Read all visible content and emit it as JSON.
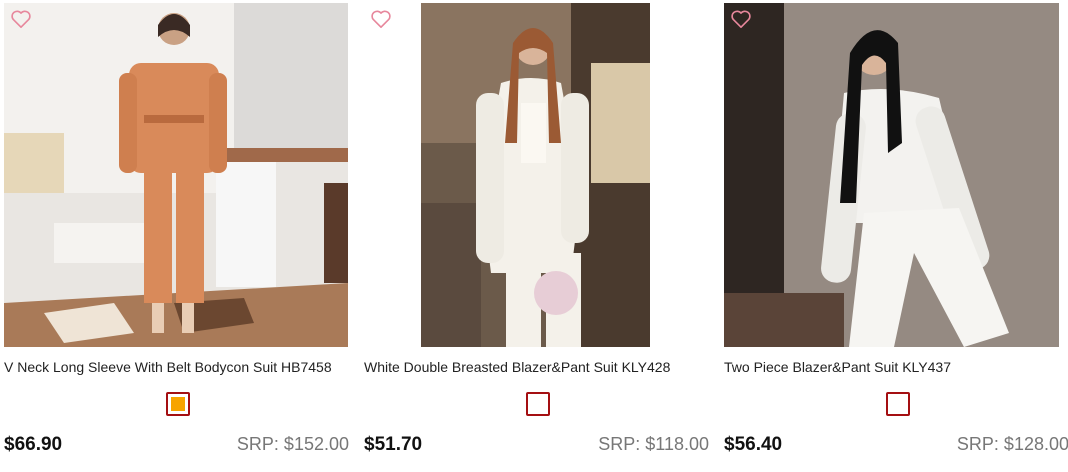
{
  "products": [
    {
      "title": "V Neck Long Sleeve With Belt Bodycon Suit HB7458",
      "price": "$66.90",
      "srp": "SRP: $152.00",
      "swatch_color": "#f7a400",
      "wishlist_icon": "heart-outline-icon"
    },
    {
      "title": "White Double Breasted Blazer&Pant Suit KLY428",
      "price": "$51.70",
      "srp": "SRP: $118.00",
      "swatch_color": "#ffffff",
      "wishlist_icon": "heart-outline-icon"
    },
    {
      "title": "Two Piece Blazer&Pant Suit KLY437",
      "price": "$56.40",
      "srp": "SRP: $128.00",
      "swatch_color": "#ffffff",
      "wishlist_icon": "heart-outline-icon"
    }
  ],
  "colors": {
    "swatch_border": "#a40f12",
    "heart": "#e7879c",
    "srp_text": "#777777"
  }
}
